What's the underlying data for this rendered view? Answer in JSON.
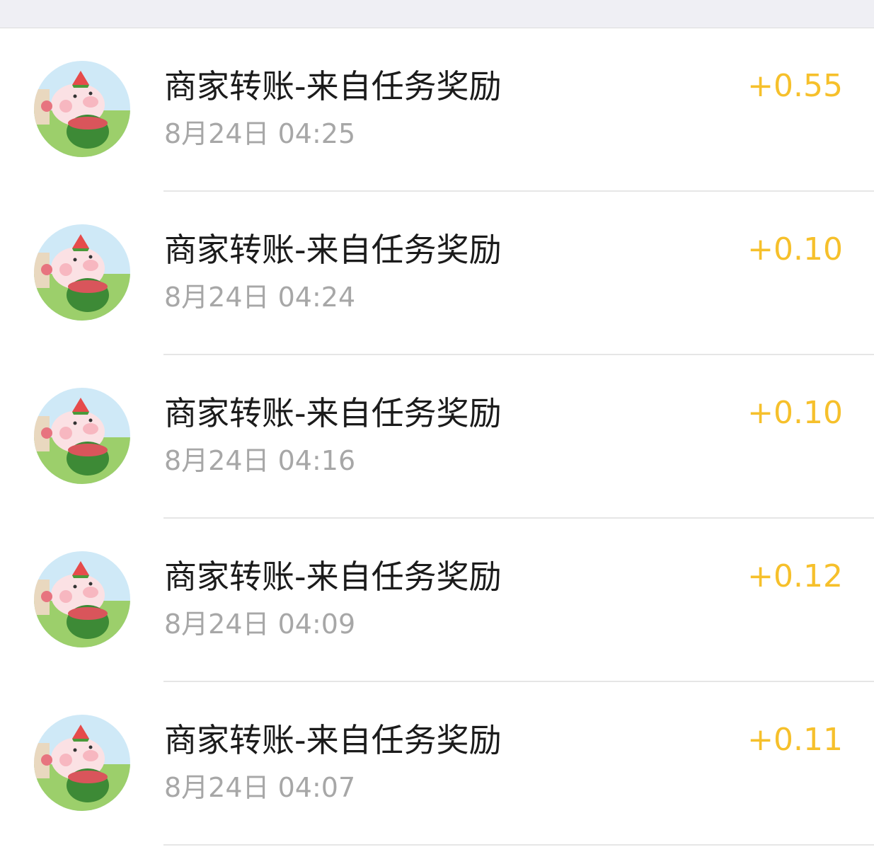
{
  "colors": {
    "amount": "#f6c02b",
    "title": "#1b1b1b",
    "time": "#a7a7a7",
    "divider": "#e6e6e6",
    "top_strip": "#efeff4"
  },
  "avatar_icon": "pig-with-watermelon-avatar",
  "transactions": [
    {
      "title": "商家转账-来自任务奖励",
      "time": "8月24日 04:25",
      "amount": "+0.55"
    },
    {
      "title": "商家转账-来自任务奖励",
      "time": "8月24日 04:24",
      "amount": "+0.10"
    },
    {
      "title": "商家转账-来自任务奖励",
      "time": "8月24日 04:16",
      "amount": "+0.10"
    },
    {
      "title": "商家转账-来自任务奖励",
      "time": "8月24日 04:09",
      "amount": "+0.12"
    },
    {
      "title": "商家转账-来自任务奖励",
      "time": "8月24日 04:07",
      "amount": "+0.11"
    }
  ]
}
